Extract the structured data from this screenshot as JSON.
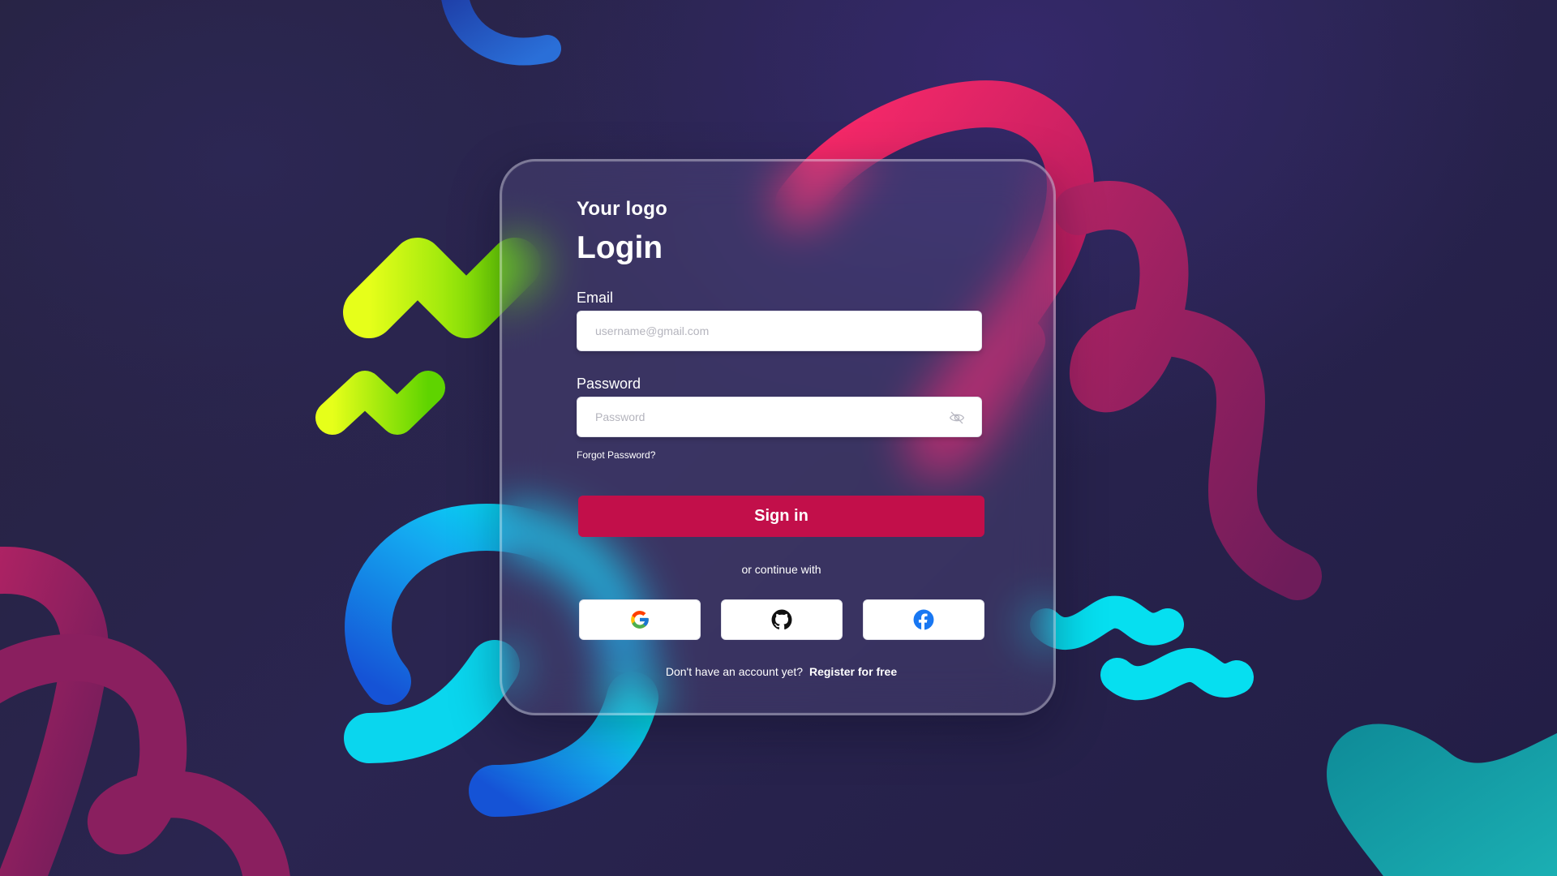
{
  "brand": {
    "logo_text": "Your logo"
  },
  "form": {
    "title": "Login",
    "email_label": "Email",
    "email_placeholder": "username@gmail.com",
    "password_label": "Password",
    "password_placeholder": "Password",
    "forgot_password": "Forgot Password?",
    "submit_label": "Sign in",
    "divider_text": "or continue with",
    "register_prompt": "Don't have an account yet?",
    "register_link": "Register for free"
  },
  "social_buttons": [
    {
      "provider": "google",
      "icon": "google-icon"
    },
    {
      "provider": "github",
      "icon": "github-icon"
    },
    {
      "provider": "facebook",
      "icon": "facebook-icon"
    }
  ],
  "colors": {
    "background": "#2a2550",
    "accent_button": "#c20f4a",
    "shape_pink": "#ff1f5f",
    "shape_magenta": "#a01b5e",
    "shape_lime": "#8fe000",
    "shape_cyan": "#00e5f5",
    "shape_blue": "#1a44c8",
    "shape_teal": "#13a1a8"
  }
}
